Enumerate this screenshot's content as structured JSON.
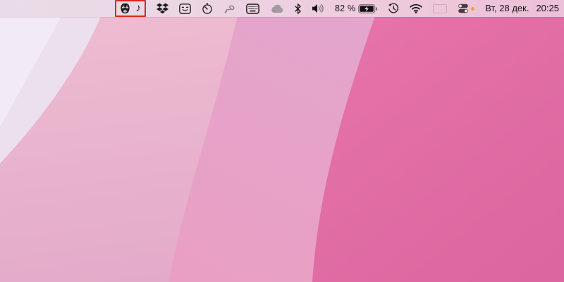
{
  "desktop": {
    "wallpaper_colors": {
      "band_lightest": "#ecdfee",
      "band_light_pink": "#e8b2cd",
      "band_mid_pink": "#e6a3c9",
      "band_saturated_pink": "#de68a2"
    }
  },
  "menubar": {
    "annotation": {
      "type": "red-highlight-box",
      "color": "#dc2722"
    },
    "music_note_glyph": "♪",
    "battery": {
      "percent_label": "82 %",
      "charging": true
    },
    "clock": {
      "date_label": "Вт, 28 дек.",
      "time_label": "20:25"
    },
    "icons": [
      {
        "name": "face-mask-icon"
      },
      {
        "name": "music-note-icon"
      },
      {
        "name": "dropbox-icon"
      },
      {
        "name": "smiley-square-icon"
      },
      {
        "name": "timer-icon"
      },
      {
        "name": "spiral-icon"
      },
      {
        "name": "keyboard-icon"
      },
      {
        "name": "cloud-icon"
      },
      {
        "name": "bluetooth-icon"
      },
      {
        "name": "volume-icon"
      },
      {
        "name": "battery-icon"
      },
      {
        "name": "time-machine-icon"
      },
      {
        "name": "wifi-icon"
      },
      {
        "name": "russian-flag-icon"
      },
      {
        "name": "toggle-switches-icon"
      },
      {
        "name": "orange-status-dot"
      }
    ]
  }
}
